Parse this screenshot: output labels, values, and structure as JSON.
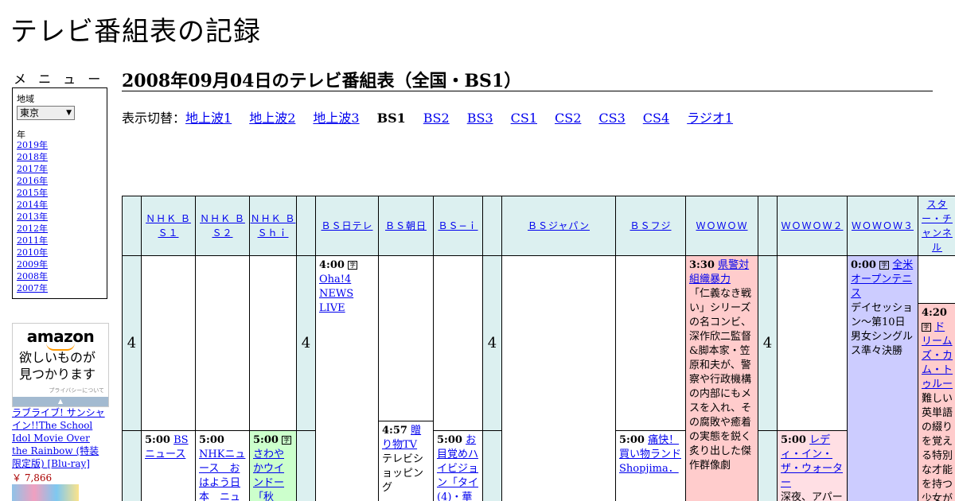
{
  "site": {
    "title": "テレビ番組表の記録"
  },
  "menu": {
    "label": "メ ニ ュ ー",
    "region_label": "地域",
    "region_value": "東京",
    "year_label": "年",
    "years": [
      "2019年",
      "2018年",
      "2017年",
      "2016年",
      "2015年",
      "2014年",
      "2013年",
      "2012年",
      "2011年",
      "2010年",
      "2009年",
      "2008年",
      "2007年"
    ]
  },
  "ad": {
    "brand": "amazon",
    "message_line1": "欲しいものが",
    "message_line2": "見つかります",
    "privacy": "プライバシーについて",
    "product_title": "ラブライブ! サンシャイン!!The School Idol Movie Over the Rainbow (特装限定版) [Blu-ray]",
    "product_price": "￥ 7,866"
  },
  "page": {
    "heading": "2008年09月04日のテレビ番組表（全国・BS1）"
  },
  "switcher": {
    "label": "表示切替：",
    "items": [
      {
        "label": "地上波1",
        "current": false
      },
      {
        "label": "地上波2",
        "current": false
      },
      {
        "label": "地上波3",
        "current": false
      },
      {
        "label": "BS1",
        "current": true
      },
      {
        "label": "BS2",
        "current": false
      },
      {
        "label": "BS3",
        "current": false
      },
      {
        "label": "CS1",
        "current": false
      },
      {
        "label": "CS2",
        "current": false
      },
      {
        "label": "CS3",
        "current": false
      },
      {
        "label": "CS4",
        "current": false
      },
      {
        "label": "ラジオ1",
        "current": false
      }
    ]
  },
  "grid": {
    "hour": "4",
    "channels": [
      "ＮＨＫ ＢＳ１",
      "ＮＨＫ ＢＳ２",
      "ＮＨＫ ＢＳｈｉ",
      "ＢＳ日テレ",
      "ＢＳ朝日",
      "ＢＳ−ｉ",
      "ＢＳジャパン",
      "ＢＳフジ",
      "ＷＯＷＯＷ",
      "ＷＯＷＯＷ２",
      "ＷＯＷＯＷ３",
      "スター・チャンネル"
    ],
    "programs": {
      "bs1_500": {
        "time": "5:00",
        "title": "BSニュース"
      },
      "bs2_500": {
        "time": "5:00",
        "title": "NHKニュース　おはよう日本　ニュース"
      },
      "bshi_500": {
        "time": "5:00",
        "icon": "字",
        "title": "さわやかウインドー「秋"
      },
      "ntv_400": {
        "time": "4:00",
        "icon": "字",
        "title": "Oha!4 NEWS LIVE"
      },
      "asahi_457": {
        "time": "4:57",
        "title": "贈り物TV",
        "desc": "テレビショッピング"
      },
      "bsi_500": {
        "time": "5:00",
        "title": "お目覚めハイビジョン「タイ(4)・華"
      },
      "fuji_500": {
        "time": "5:00",
        "title": "痛快！買い物ランド Shopjima．"
      },
      "wowow_330": {
        "time": "3:30",
        "title": "県警対組織暴力",
        "desc": "「仁義なき戦い」シリーズの名コンビ、深作欣二監督&脚本家・笠原和夫が、警察や行政機構の内部にもメスを入れ、その腐敗や癒着の実態を鋭く炙り出した傑作群像劇"
      },
      "wowow2_500": {
        "time": "5:00",
        "title": "レディ・イン・ザ・ウォーター",
        "desc": "深夜、アパートのプールに"
      },
      "wowow3_000": {
        "time": "0:00",
        "icon": "字",
        "title": "全米オープンテニス",
        "desc": "デイセッション～第10日男女シングルス準々決勝"
      },
      "star_420": {
        "time": "4:20",
        "icon": "字",
        "title": "ドリームズ・カム・トゥルー",
        "desc": "難しい英単語の綴りを覚える特別な才能を持つ少女が"
      }
    }
  }
}
